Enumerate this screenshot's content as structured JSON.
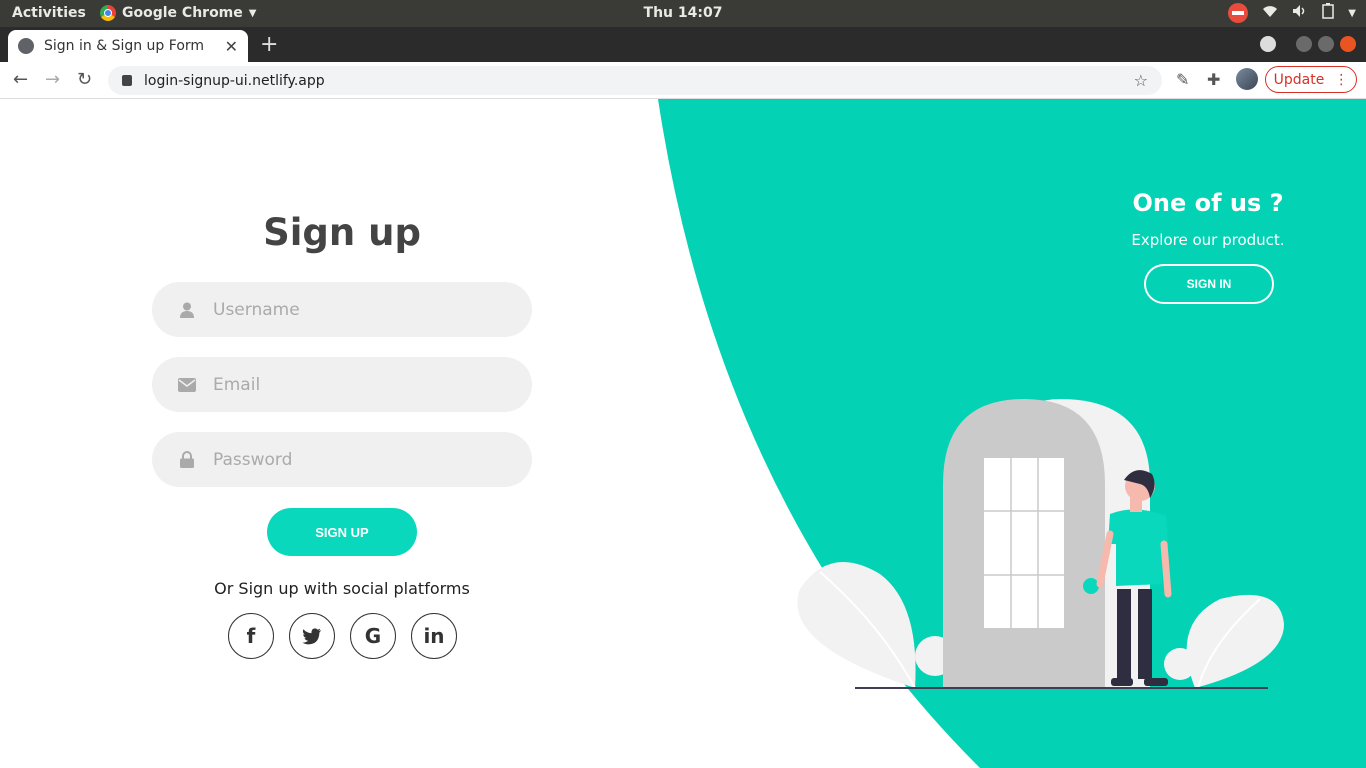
{
  "system_bar": {
    "activities": "Activities",
    "app_name": "Google Chrome",
    "clock": "Thu 14:07"
  },
  "browser": {
    "tab_title": "Sign in & Sign up Form",
    "url": "login-signup-ui.netlify.app",
    "update_label": "Update"
  },
  "signup": {
    "title": "Sign up",
    "username_placeholder": "Username",
    "email_placeholder": "Email",
    "password_placeholder": "Password",
    "submit_label": "SIGN UP",
    "social_text": "Or Sign up with social platforms",
    "socials": [
      "facebook",
      "twitter",
      "google",
      "linkedin"
    ]
  },
  "panel": {
    "title": "One of us ?",
    "subtitle": "Explore our product.",
    "signin_label": "SIGN IN"
  },
  "colors": {
    "accent": "#0ad8bc",
    "panel": "#03d2b5",
    "chrome_dark": "#2b2b2b",
    "ubuntu_bar": "#3a3a37"
  }
}
